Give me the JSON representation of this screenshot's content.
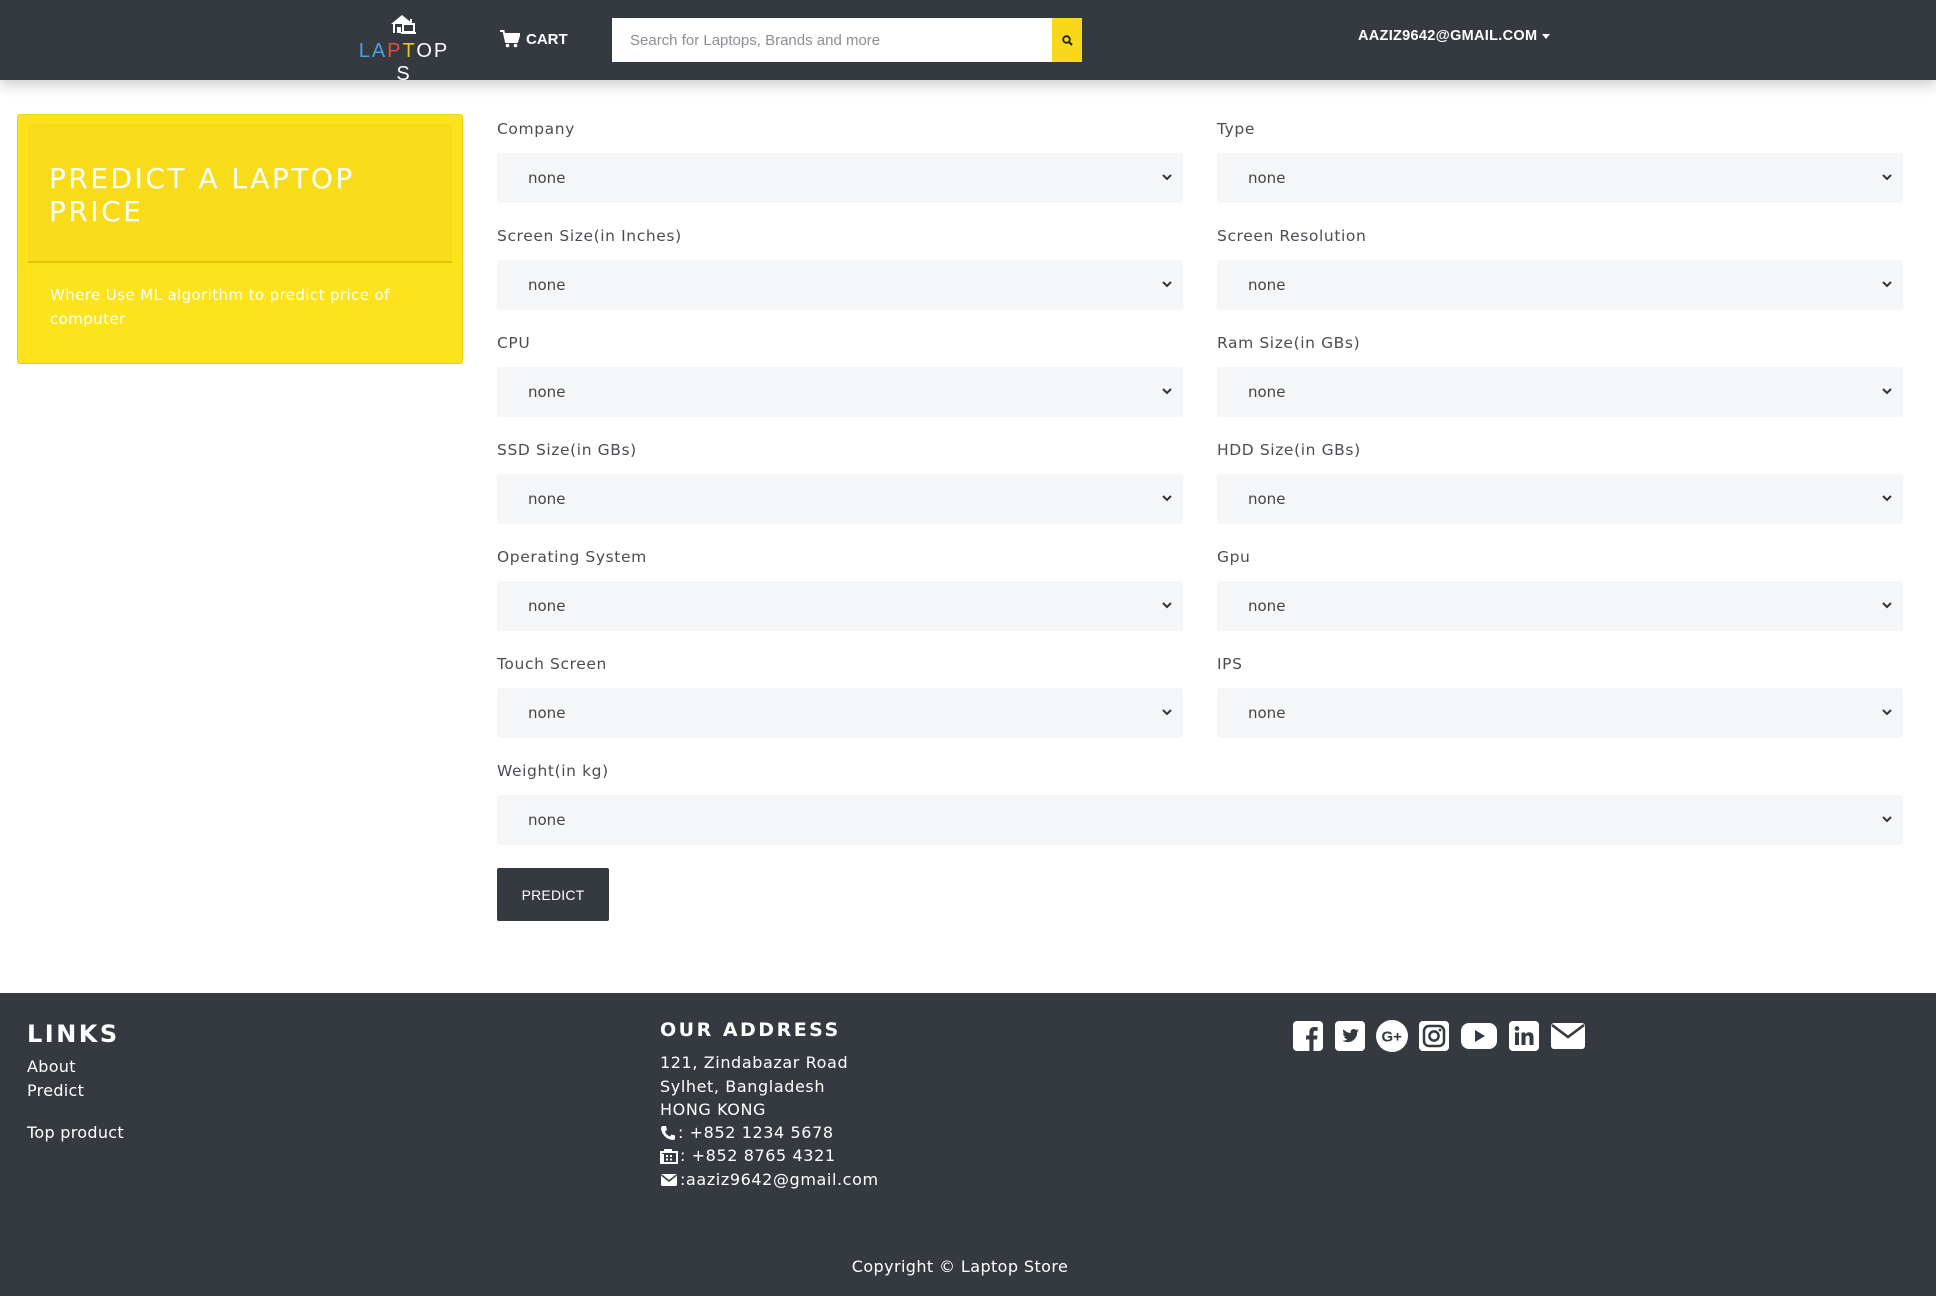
{
  "navbar": {
    "brand_letters": [
      "LA",
      "P",
      "T",
      "OP S"
    ],
    "cart_label": "CART",
    "search_placeholder": "Search for Laptops, Brands and more",
    "user_label": "AAZIZ9642@GMAIL.COM"
  },
  "card": {
    "title": "PREDICT A LAPTOP PRICE",
    "description": "Where Use ML algorithm to predict price of computer"
  },
  "form": {
    "fields": [
      {
        "label": "Company",
        "value": "none"
      },
      {
        "label": "Type",
        "value": "none"
      },
      {
        "label": "Screen Size(in Inches)",
        "value": "none"
      },
      {
        "label": "Screen Resolution",
        "value": "none"
      },
      {
        "label": "CPU",
        "value": "none"
      },
      {
        "label": "Ram Size(in GBs)",
        "value": "none"
      },
      {
        "label": "SSD Size(in GBs)",
        "value": "none"
      },
      {
        "label": "HDD Size(in GBs)",
        "value": "none"
      },
      {
        "label": "Operating System",
        "value": "none"
      },
      {
        "label": "Gpu",
        "value": "none"
      },
      {
        "label": "Touch Screen",
        "value": "none"
      },
      {
        "label": "IPS",
        "value": "none"
      },
      {
        "label": "Weight(in kg)",
        "value": "none"
      }
    ],
    "submit_label": "PREDICT"
  },
  "footer": {
    "links_title": "LINKS",
    "links": [
      "About",
      "Predict",
      "Top product"
    ],
    "address_title": "OUR ADDRESS",
    "address_lines": [
      "121, Zindabazar Road",
      "Sylhet, Bangladesh",
      "HONG KONG"
    ],
    "phone": ": +852 1234 5678",
    "fax": ": +852 8765 4321",
    "email": ":aaziz9642@gmail.com",
    "social_icons": [
      "facebook-icon",
      "twitter-icon",
      "google-plus-icon",
      "instagram-icon",
      "youtube-icon",
      "linkedin-icon",
      "envelope-icon"
    ],
    "copyright": "Copyright © Laptop Store"
  },
  "colors": {
    "navbar_bg": "#343a40",
    "accent_yellow": "#fde31c",
    "select_bg": "#f5f6f7"
  }
}
